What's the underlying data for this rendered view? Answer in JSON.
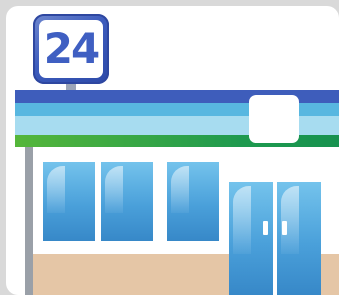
{
  "store_sign": {
    "text": "24"
  },
  "colors": {
    "sign_blue": "#3f5fc2",
    "stripe_dark_blue": "#3e5dbb",
    "stripe_light_blue": "#58b7e0",
    "stripe_pale_blue": "#a7dcf0",
    "stripe_green": "#1e9a4f",
    "glass_blue": "#4aa0da",
    "base_tan": "#e5c6a6"
  },
  "icon": {
    "name": "convenience-store-icon"
  }
}
